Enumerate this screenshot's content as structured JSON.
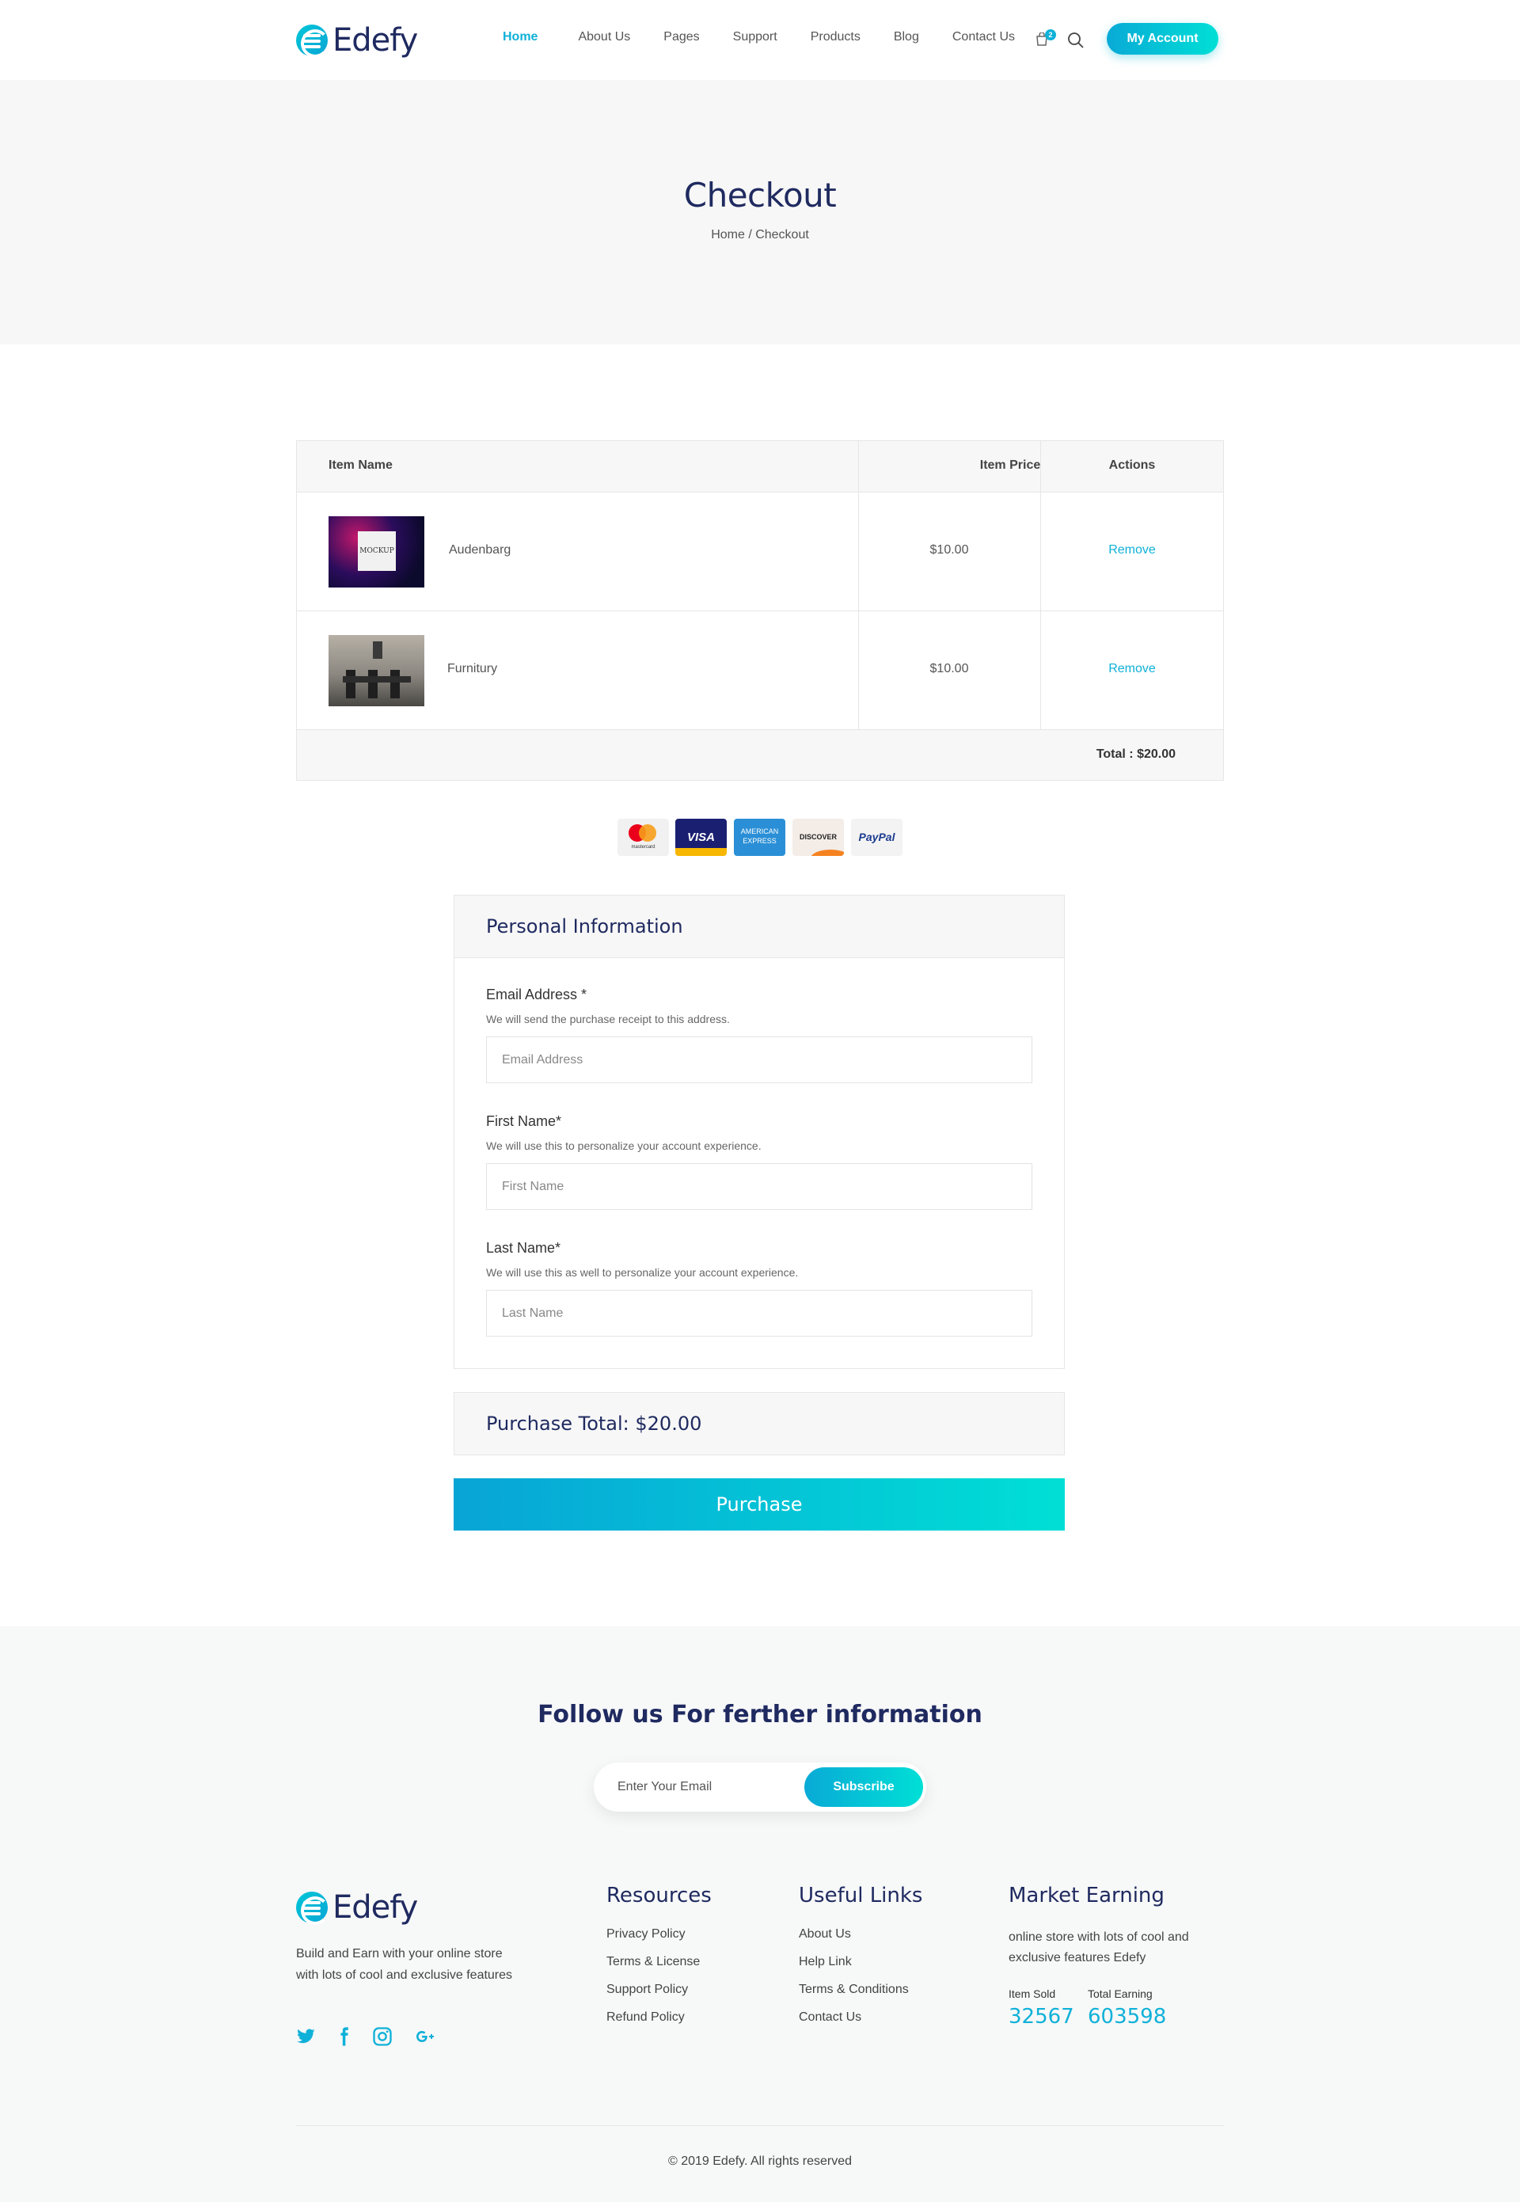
{
  "brand": {
    "name": "Edefy"
  },
  "nav": {
    "items": [
      "Home",
      "About Us",
      "Pages",
      "Support",
      "Products",
      "Blog",
      "Contact Us"
    ],
    "active": "Home",
    "cart_count": "2",
    "account_label": "My Account"
  },
  "banner": {
    "title": "Checkout",
    "breadcrumb": "Home / Checkout"
  },
  "cart": {
    "headers": {
      "name": "Item Name",
      "price": "Item Price",
      "actions": "Actions"
    },
    "items": [
      {
        "name": "Audenbarg",
        "price": "$10.00",
        "action": "Remove",
        "thumb_text": "MOCKUP"
      },
      {
        "name": "Furnitury",
        "price": "$10.00",
        "action": "Remove"
      }
    ],
    "total": "Total : $20.00"
  },
  "payment_methods": {
    "mastercard": "mastercard",
    "visa": "VISA",
    "amex": "AMERICAN EXPRESS",
    "discover": "DISCOVER",
    "paypal": "PayPal"
  },
  "personal_info": {
    "title": "Personal Information",
    "email": {
      "label": "Email Address *",
      "hint": "We will send the purchase receipt to this address.",
      "placeholder": "Email Address",
      "value": ""
    },
    "first_name": {
      "label": "First Name*",
      "hint": "We will use this to personalize your account experience.",
      "placeholder": "First Name",
      "value": ""
    },
    "last_name": {
      "label": "Last Name*",
      "hint": "We will use this as well to personalize your account experience.",
      "placeholder": "Last Name",
      "value": ""
    }
  },
  "purchase": {
    "total_label": "Purchase Total: $20.00",
    "button_label": "Purchase"
  },
  "footer": {
    "follow_title": "Follow us For ferther information",
    "subscribe": {
      "placeholder": "Enter Your Email",
      "button_label": "Subscribe"
    },
    "about": "Build and Earn with your online store with lots of cool and exclusive features",
    "social_icons": [
      "twitter-icon",
      "facebook-icon",
      "instagram-icon",
      "google-plus-icon"
    ],
    "resources": {
      "title": "Resources",
      "links": [
        "Privacy Policy",
        "Terms & License",
        "Support Policy",
        "Refund Policy"
      ]
    },
    "useful_links": {
      "title": "Useful Links",
      "links": [
        "About Us",
        "Help Link",
        "Terms & Conditions",
        "Contact Us"
      ]
    },
    "market": {
      "title": "Market Earning",
      "text": "online store with lots of cool and exclusive features Edefy",
      "item_sold_label": "Item Sold",
      "item_sold": "32567",
      "total_earning_label": "Total Earning",
      "total_earning": "603598"
    },
    "copyright": "© 2019 Edefy. All rights reserved"
  },
  "colors": {
    "accent": "#0fb1d8",
    "heading": "#1f2a60",
    "gradient_end": "#00dfd6"
  }
}
